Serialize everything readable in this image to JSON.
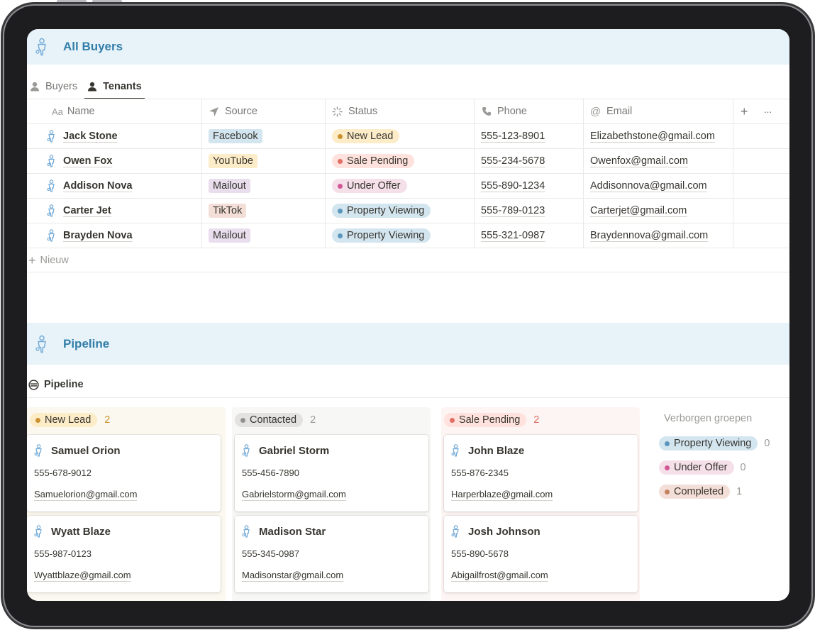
{
  "colors": {
    "banner_bg": "#e7f3f8",
    "banner_title": "#337ea9",
    "brown_tag_bg": "#f4eeee",
    "blue_tag_bg": "#d3e5ef",
    "yellow_tag_bg": "#fdecc8",
    "purple_tag_bg": "#e8deee",
    "red_tag_bg": "#ffe2dd",
    "orange_pill_bg": "#fadec9",
    "pink_pill_bg": "#f5e0e9",
    "gray_pill_bg": "#e3e2e0"
  },
  "icons": {
    "database": "person-with-key-icon",
    "person": "person-icon",
    "source": "send-arrow-icon",
    "status": "loading-spinner-icon",
    "phone": "phone-icon",
    "email": "at-sign-icon",
    "board": "board-view-icon"
  },
  "buyers": {
    "title": "All Buyers",
    "tabs": [
      {
        "label": "Buyers",
        "active": false
      },
      {
        "label": "Tenants",
        "active": true
      }
    ],
    "columns": {
      "name": "Name",
      "name_prefix": "Aa",
      "source": "Source",
      "status": "Status",
      "phone": "Phone",
      "email": "Email",
      "add": "+",
      "more": "···"
    },
    "rows": [
      {
        "name": "Jack Stone",
        "source": "Facebook",
        "status": "New Lead",
        "phone": "555-123-8901",
        "email": "Elizabethstone@gmail.com"
      },
      {
        "name": "Owen Fox",
        "source": "YouTube",
        "status": "Sale Pending",
        "phone": "555-234-5678",
        "email": "Owenfox@gmail.com"
      },
      {
        "name": "Addison Nova",
        "source": "Mailout",
        "status": "Under Offer",
        "phone": "555-890-1234",
        "email": "Addisonnova@gmail.com"
      },
      {
        "name": "Carter Jet",
        "source": "TikTok",
        "status": "Property Viewing",
        "phone": "555-789-0123",
        "email": "Carterjet@gmail.com"
      },
      {
        "name": "Brayden Nova",
        "source": "Mailout",
        "status": "Property Viewing",
        "phone": "555-321-0987",
        "email": "Braydennova@gmail.com"
      }
    ],
    "new_label": "Nieuw"
  },
  "pipeline": {
    "title": "Pipeline",
    "view_label": "Pipeline",
    "groups": [
      {
        "label": "New Lead",
        "count": "2",
        "cards": [
          {
            "name": "Samuel Orion",
            "phone": "555-678-9012",
            "email": "Samuelorion@gmail.com"
          },
          {
            "name": "Wyatt Blaze",
            "phone": "555-987-0123",
            "email": "Wyattblaze@gmail.com"
          }
        ]
      },
      {
        "label": "Contacted",
        "count": "2",
        "cards": [
          {
            "name": "Gabriel Storm",
            "phone": "555-456-7890",
            "email": "Gabrielstorm@gmail.com"
          },
          {
            "name": "Madison Star",
            "phone": "555-345-0987",
            "email": "Madisonstar@gmail.com"
          }
        ]
      },
      {
        "label": "Sale Pending",
        "count": "2",
        "cards": [
          {
            "name": "John Blaze",
            "phone": "555-876-2345",
            "email": "Harperblaze@gmail.com"
          },
          {
            "name": "Josh Johnson",
            "phone": "555-890-5678",
            "email": "Abigailfrost@gmail.com"
          }
        ]
      }
    ],
    "hidden_title": "Verborgen groepen",
    "hidden_groups": [
      {
        "label": "Property Viewing",
        "count": "0"
      },
      {
        "label": "Under Offer",
        "count": "0"
      },
      {
        "label": "Completed",
        "count": "1"
      }
    ]
  }
}
